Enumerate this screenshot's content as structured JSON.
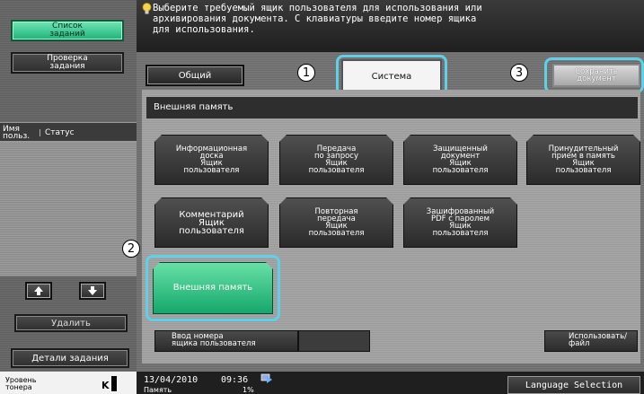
{
  "left_panel": {
    "job_list_label": "Список\nзаданий",
    "job_check_label": "Проверка\nзадания",
    "user_col_label": "Имя\nпольз.",
    "status_col_label": "Статус",
    "up_icon": "arrow-up-icon",
    "down_icon": "arrow-down-icon",
    "delete_label": "Удалить",
    "job_details_label": "Детали задания",
    "toner_label": "Уровень\nтонера",
    "toner_color": "K"
  },
  "message": {
    "icon": "lightbulb-icon",
    "text": "Выберите требуемый ящик пользователя для использования или\nархивирования документа. С клавиатуры введите номер ящика\nдля использования."
  },
  "tabs": [
    {
      "label": "Общий"
    },
    {
      "label": "Система"
    }
  ],
  "callouts": [
    "1",
    "2",
    "3"
  ],
  "save_document_label": "Сохранить\nдокумент",
  "section_title": "Внешняя память",
  "boxes_row1": [
    {
      "label": "Информационная\nдоска\nЯщик\nпользователя"
    },
    {
      "label": "Передача\nпо запросу\nЯщик\nпользователя"
    },
    {
      "label": "Защищенный\nдокумент\nЯщик\nпользователя"
    },
    {
      "label": "Принудительный\nприем в память\nЯщик\nпользователя"
    }
  ],
  "boxes_row2": [
    {
      "label": "Комментарий\nЯщик\nпользователя"
    },
    {
      "label": "Повторная\nпередача\nЯщик\nпользователя"
    },
    {
      "label": "Зашифрованный\nPDF с паролем\nЯщик\nпользователя"
    }
  ],
  "selected_box_label": "Внешняя память",
  "user_box_number_label": "Ввод номера\nящика пользователя",
  "use_file_label": "Использовать/\nфайл",
  "status_bar": {
    "date": "13/04/2010",
    "time": "09:36",
    "memory_label": "Память",
    "memory_value": "1%",
    "language_label": "Language Selection"
  },
  "colors": {
    "accent_green": "#1fb27a",
    "highlight_ring": "#5fd0e8"
  }
}
